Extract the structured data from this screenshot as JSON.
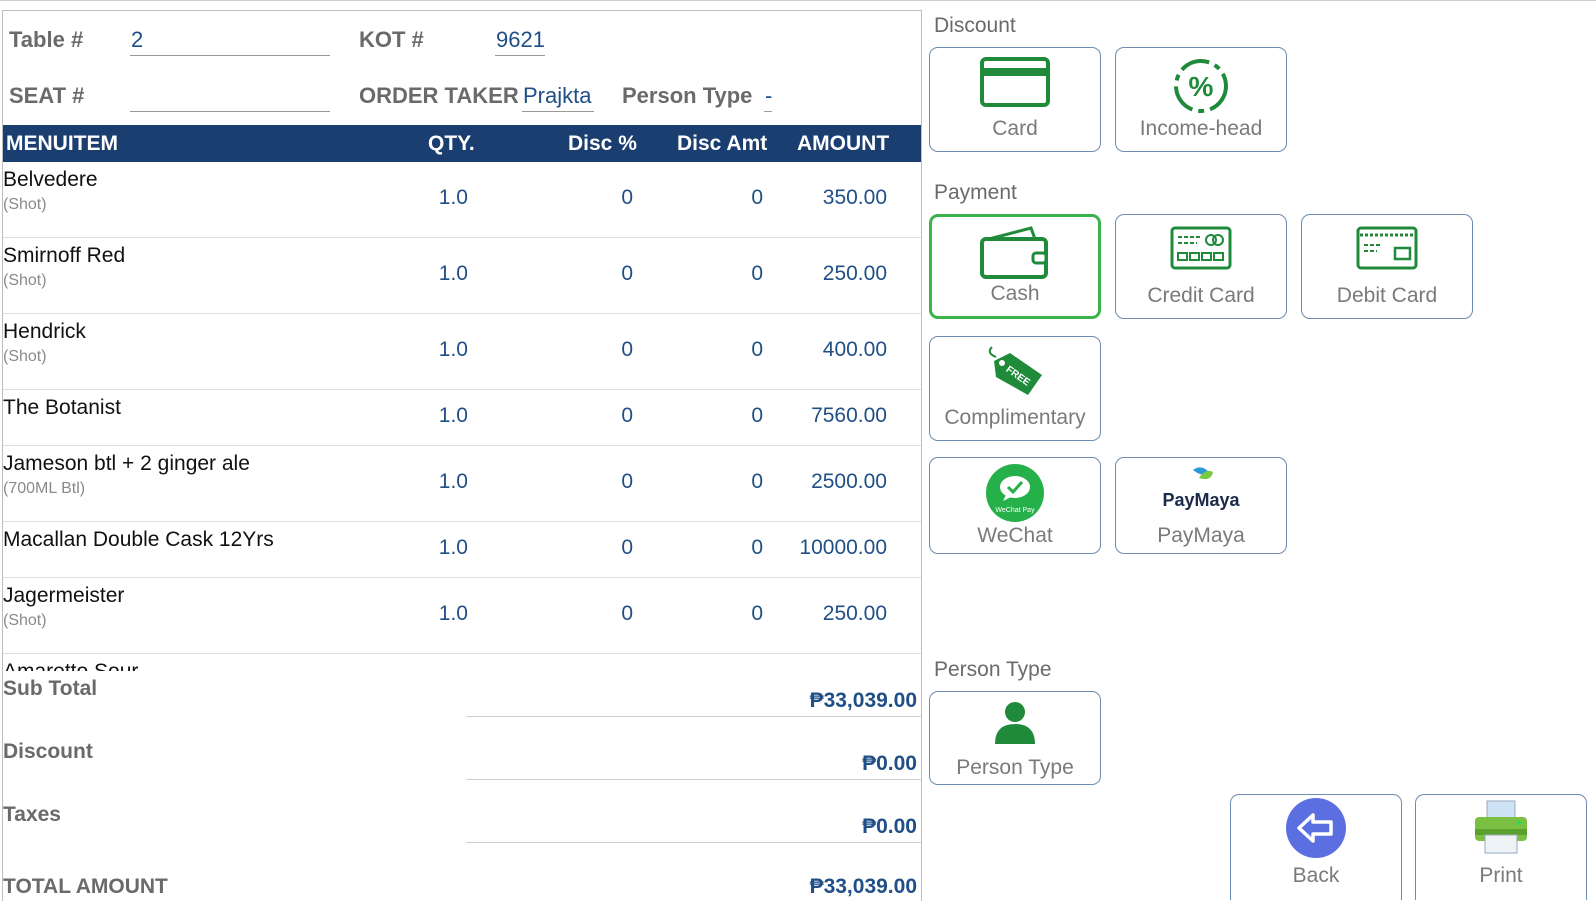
{
  "header": {
    "table_label": "Table #",
    "table_value": "2",
    "kot_label": "KOT #",
    "kot_value": "9621",
    "seat_label": "SEAT #",
    "seat_value": "",
    "order_taker_label": "ORDER TAKER",
    "order_taker_value": "Prajkta",
    "person_type_label": "Person Type",
    "person_type_value": "-"
  },
  "columns": {
    "menu_item": "MENUITEM",
    "qty": "QTY.",
    "disc_pct": "Disc %",
    "disc_amt": "Disc Amt",
    "amount": "AMOUNT"
  },
  "items": [
    {
      "name": "Belvedere",
      "sub": "(Shot)",
      "qty": "1.0",
      "disc_pct": "0",
      "disc_amt": "0",
      "amount": "350.00"
    },
    {
      "name": "Smirnoff Red",
      "sub": "(Shot)",
      "qty": "1.0",
      "disc_pct": "0",
      "disc_amt": "0",
      "amount": "250.00"
    },
    {
      "name": "Hendrick",
      "sub": "(Shot)",
      "qty": "1.0",
      "disc_pct": "0",
      "disc_amt": "0",
      "amount": "400.00"
    },
    {
      "name": "The Botanist",
      "sub": "",
      "qty": "1.0",
      "disc_pct": "0",
      "disc_amt": "0",
      "amount": "7560.00"
    },
    {
      "name": "Jameson btl + 2 ginger ale",
      "sub": "(700ML Btl)",
      "qty": "1.0",
      "disc_pct": "0",
      "disc_amt": "0",
      "amount": "2500.00"
    },
    {
      "name": "Macallan Double Cask 12Yrs",
      "sub": "",
      "qty": "1.0",
      "disc_pct": "0",
      "disc_amt": "0",
      "amount": "10000.00"
    },
    {
      "name": "Jagermeister",
      "sub": "(Shot)",
      "qty": "1.0",
      "disc_pct": "0",
      "disc_amt": "0",
      "amount": "250.00"
    },
    {
      "name": "Amaretto Sour",
      "sub": "",
      "qty": "",
      "disc_pct": "",
      "disc_amt": "",
      "amount": ""
    }
  ],
  "totals": {
    "sub_total_label": "Sub Total",
    "sub_total_value": "₱33,039.00",
    "discount_label": "Discount",
    "discount_value": "₱0.00",
    "taxes_label": "Taxes",
    "taxes_value": "₱0.00",
    "total_label": "TOTAL AMOUNT",
    "total_value": "₱33,039.00"
  },
  "discount_section": {
    "title": "Discount",
    "buttons": [
      {
        "label": "Card",
        "icon": "card-icon"
      },
      {
        "label": "Income-head",
        "icon": "percent-icon"
      }
    ]
  },
  "payment_section": {
    "title": "Payment",
    "buttons": [
      {
        "label": "Cash",
        "icon": "wallet-icon",
        "selected": true
      },
      {
        "label": "Credit Card",
        "icon": "credit-card-icon"
      },
      {
        "label": "Debit Card",
        "icon": "debit-card-icon"
      },
      {
        "label": "Complimentary",
        "icon": "free-tag-icon"
      },
      {
        "label": "WeChat",
        "icon": "wechat-pay-icon",
        "icon_text": "WeChat Pay"
      },
      {
        "label": "PayMaya",
        "icon": "paymaya-icon",
        "icon_text": "PayMaya"
      }
    ]
  },
  "person_type_section": {
    "title": "Person Type",
    "button": {
      "label": "Person Type",
      "icon": "person-icon"
    }
  },
  "actions": {
    "back_label": "Back",
    "print_label": "Print"
  },
  "colors": {
    "header_bar": "#1b3e70",
    "value_blue": "#1f4f86",
    "icon_green": "#1f8a3a",
    "selected_border": "#3cb24a",
    "tile_border": "#6e8bb0"
  }
}
